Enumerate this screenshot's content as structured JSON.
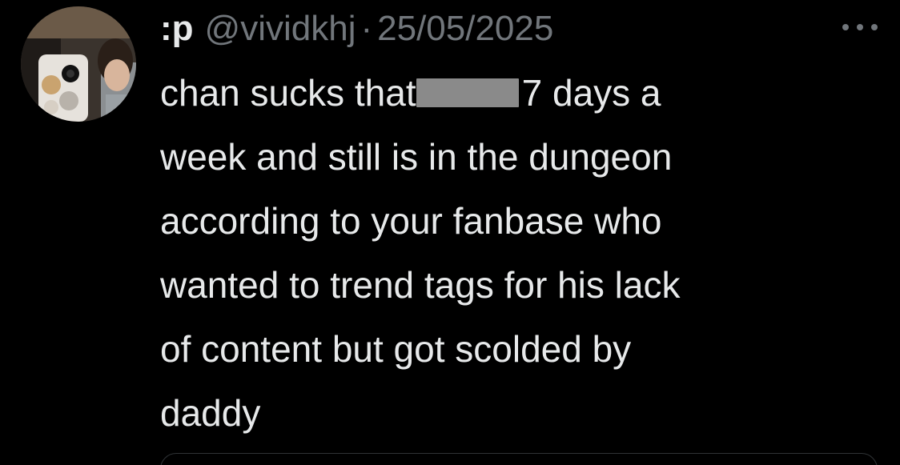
{
  "tweet": {
    "display_name": ":p",
    "handle": "@vividkhj",
    "separator": "·",
    "date": "25/05/2025",
    "more_icon": "more-horizontal-icon",
    "text_before_redaction": "chan sucks that",
    "text_after_redaction": "7 days a",
    "lines": [
      "week and still is in the dungeon",
      "according to your fanbase who",
      "wanted to trend tags for his lack",
      "of content but got scolded by",
      "daddy"
    ]
  },
  "colors": {
    "background": "#000000",
    "primary_text": "#e7e9ea",
    "secondary_text": "#71767b",
    "redaction": "#8a8a8a"
  }
}
